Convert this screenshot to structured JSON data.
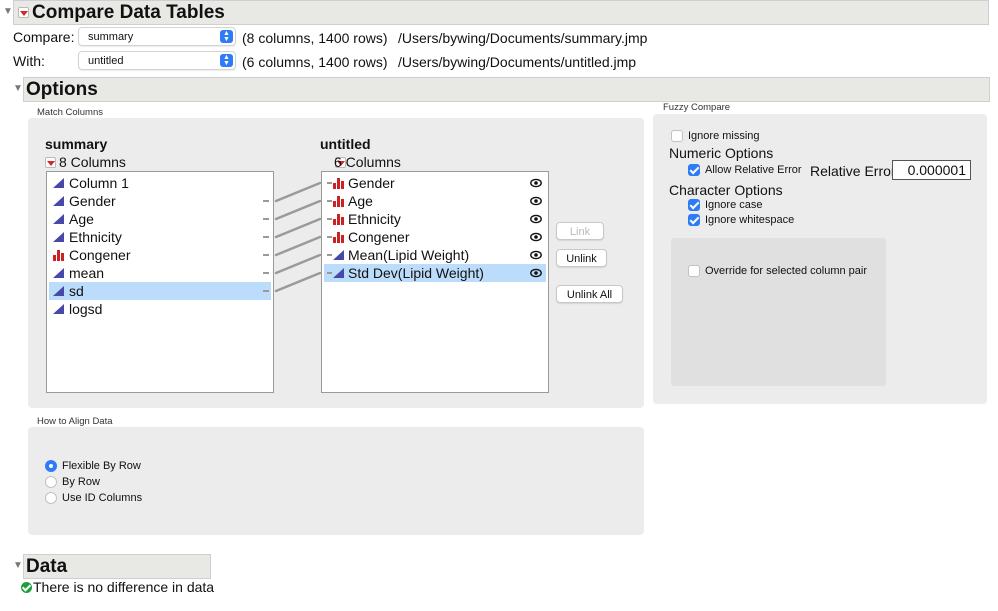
{
  "compare_panel": {
    "title": "Compare Data Tables",
    "compare_label": "Compare:",
    "compare_table": "summary",
    "compare_info": "(8 columns, 1400 rows)",
    "compare_path": "/Users/bywing/Documents/summary.jmp",
    "with_label": "With:",
    "with_table": "untitled",
    "with_info": "(6 columns, 1400 rows)",
    "with_path": "/Users/bywing/Documents/untitled.jmp"
  },
  "options": {
    "title": "Options",
    "match_columns": {
      "label": "Match Columns",
      "left_table": "summary",
      "left_count": "8 Columns",
      "left_columns": [
        {
          "name": "Column 1",
          "type": "continuous"
        },
        {
          "name": "Gender",
          "type": "continuous"
        },
        {
          "name": "Age",
          "type": "continuous"
        },
        {
          "name": "Ethnicity",
          "type": "continuous"
        },
        {
          "name": "Congener",
          "type": "nominal"
        },
        {
          "name": "mean",
          "type": "continuous"
        },
        {
          "name": "sd",
          "type": "continuous",
          "selected": true
        },
        {
          "name": "logsd",
          "type": "continuous"
        }
      ],
      "right_table": "untitled",
      "right_count": "6 Columns",
      "right_columns": [
        {
          "name": "Gender",
          "type": "nominal"
        },
        {
          "name": "Age",
          "type": "nominal"
        },
        {
          "name": "Ethnicity",
          "type": "nominal"
        },
        {
          "name": "Congener",
          "type": "nominal"
        },
        {
          "name": "Mean(Lipid Weight)",
          "type": "continuous"
        },
        {
          "name": "Std Dev(Lipid Weight)",
          "type": "continuous",
          "selected": true
        }
      ],
      "link_button": "Link",
      "unlink_button": "Unlink",
      "unlink_all_button": "Unlink All"
    },
    "fuzzy_compare": {
      "label": "Fuzzy Compare",
      "ignore_missing": "Ignore missing",
      "numeric_options": "Numeric Options",
      "allow_relative_error": "Allow Relative Error",
      "relative_error_label": "Relative Error",
      "relative_error_value": "0.000001",
      "character_options": "Character Options",
      "ignore_case": "Ignore case",
      "ignore_whitespace": "Ignore whitespace",
      "override": "Override for selected column pair"
    },
    "align": {
      "label": "How to Align Data",
      "options": [
        "Flexible By Row",
        "By Row",
        "Use ID Columns"
      ],
      "selected": "Flexible By Row"
    }
  },
  "data_section": {
    "title": "Data",
    "message": "There is no difference in data"
  },
  "colors": {
    "accent_blue": "#2d7cf6",
    "selection": "#bcdcfb",
    "continuous_icon": "#4848a8",
    "nominal_icon": "#cc2222",
    "success_green": "#1e9e3a"
  }
}
